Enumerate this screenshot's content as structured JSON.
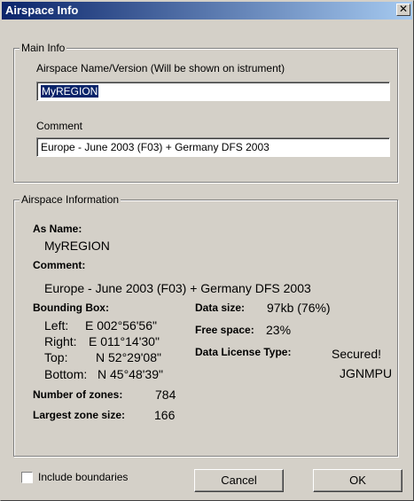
{
  "window": {
    "title": "Airspace Info",
    "close_glyph": "✕"
  },
  "main_info": {
    "legend": "Main Info",
    "name_label": "Airspace Name/Version (Will be shown on istrument)",
    "name_value": "MyREGION",
    "comment_label": "Comment",
    "comment_value": "Europe - June 2003 (F03) + Germany DFS 2003"
  },
  "airspace_info": {
    "legend": "Airspace Information",
    "as_name_label": "As Name:",
    "as_name_value": "MyREGION",
    "comment_label": "Comment:",
    "comment_value": "Europe - June 2003 (F03) + Germany DFS 2003",
    "bounding_box_label": "Bounding Box:",
    "left_label": "Left:",
    "left_value": "E 002°56'56\"",
    "right_label": "Right:",
    "right_value": "E 011°14'30\"",
    "top_label": "Top:",
    "top_value": "N 52°29'08\"",
    "bottom_label": "Bottom:",
    "bottom_value": "N 45°48'39\"",
    "zones_label": "Number of zones:",
    "zones_value": "784",
    "largest_label": "Largest zone size:",
    "largest_value": "166",
    "data_size_label": "Data size:",
    "data_size_value": "97kb (76%)",
    "free_space_label": "Free space:",
    "free_space_value": "23%",
    "license_label": "Data License Type:",
    "license_value_1": "Secured!",
    "license_value_2": "JGNMPU"
  },
  "footer": {
    "include_boundaries_label": "Include boundaries",
    "include_boundaries_checked": false,
    "cancel_label": "Cancel",
    "ok_label": "OK"
  }
}
